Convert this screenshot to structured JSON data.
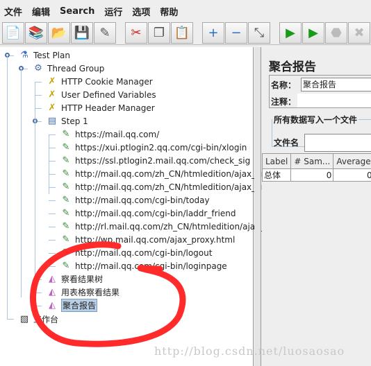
{
  "menu": [
    "文件",
    "编辑",
    "Search",
    "运行",
    "选项",
    "帮助"
  ],
  "toolbar": [
    {
      "name": "new-icon",
      "glyph": "📄"
    },
    {
      "name": "templates-icon",
      "glyph": "📚"
    },
    {
      "name": "open-icon",
      "glyph": "📂"
    },
    {
      "name": "save-icon",
      "glyph": "💾"
    },
    {
      "name": "save-as-icon",
      "glyph": "✎"
    },
    {
      "gap": true
    },
    {
      "name": "cut-icon",
      "glyph": "✂"
    },
    {
      "name": "copy-icon",
      "glyph": "❐"
    },
    {
      "name": "paste-icon",
      "glyph": "📋"
    },
    {
      "gap": true
    },
    {
      "name": "expand-icon",
      "glyph": "+"
    },
    {
      "name": "collapse-icon",
      "glyph": "−"
    },
    {
      "name": "toggle-icon",
      "glyph": "⤡"
    },
    {
      "gap": true
    },
    {
      "name": "start-icon",
      "glyph": "▶"
    },
    {
      "name": "start-no-pause-icon",
      "glyph": "▶"
    },
    {
      "name": "stop-icon",
      "glyph": "⬣"
    },
    {
      "name": "shutdown-icon",
      "glyph": "✖"
    }
  ],
  "tree": [
    {
      "label": "Test Plan",
      "level": 0,
      "icon": "flask-icon"
    },
    {
      "label": "Thread Group",
      "level": 1,
      "icon": "gear-icon"
    },
    {
      "label": "HTTP Cookie Manager",
      "level": 2,
      "icon": "wrench-icon"
    },
    {
      "label": "User Defined Variables",
      "level": 2,
      "icon": "wrench-icon"
    },
    {
      "label": "HTTP Header Manager",
      "level": 2,
      "icon": "wrench-icon"
    },
    {
      "label": "Step 1",
      "level": 2,
      "icon": "controller-icon"
    },
    {
      "label": "https://mail.qq.com/",
      "level": 3,
      "icon": "sampler-icon"
    },
    {
      "label": "https://xui.ptlogin2.qq.com/cgi-bin/xlogin",
      "level": 3,
      "icon": "sampler-icon"
    },
    {
      "label": "https://ssl.ptlogin2.mail.qq.com/check_sig",
      "level": 3,
      "icon": "sampler-icon"
    },
    {
      "label": "http://mail.qq.com/zh_CN/htmledition/ajax_proxy",
      "level": 3,
      "icon": "sampler-icon"
    },
    {
      "label": "http://mail.qq.com/zh_CN/htmledition/ajax_proxy",
      "level": 3,
      "icon": "sampler-icon"
    },
    {
      "label": "http://mail.qq.com/cgi-bin/today",
      "level": 3,
      "icon": "sampler-icon"
    },
    {
      "label": "http://mail.qq.com/cgi-bin/laddr_friend",
      "level": 3,
      "icon": "sampler-icon"
    },
    {
      "label": "http://rl.mail.qq.com/zh_CN/htmledition/ajax_proxy",
      "level": 3,
      "icon": "sampler-icon"
    },
    {
      "label": "http://wp.mail.qq.com/ajax_proxy.html",
      "level": 3,
      "icon": "sampler-icon"
    },
    {
      "label": "http://mail.qq.com/cgi-bin/logout",
      "level": 3,
      "icon": "sampler-icon"
    },
    {
      "label": "http://mail.qq.com/cgi-bin/loginpage",
      "level": 3,
      "icon": "sampler-icon"
    },
    {
      "label": "察看结果树",
      "level": 2,
      "icon": "listener-icon"
    },
    {
      "label": "用表格察看结果",
      "level": 2,
      "icon": "listener-icon"
    },
    {
      "label": "聚合报告",
      "level": 2,
      "icon": "listener-icon",
      "selected": true
    },
    {
      "label": "工作台",
      "level": 0,
      "icon": "workbench-icon"
    }
  ],
  "panel": {
    "title": "聚合报告",
    "name_label": "名称：",
    "name_value": "聚合报告",
    "comment_label": "注释：",
    "file_group": "所有数据写入一个文件",
    "filename_label": "文件名",
    "columns": [
      "Label",
      "# Sam...",
      "Average"
    ],
    "rows": [
      [
        "总体",
        "0",
        "0"
      ]
    ]
  },
  "watermark": "http://blog.csdn.net/luosaosao",
  "annotation_color": "#ff2a2a"
}
